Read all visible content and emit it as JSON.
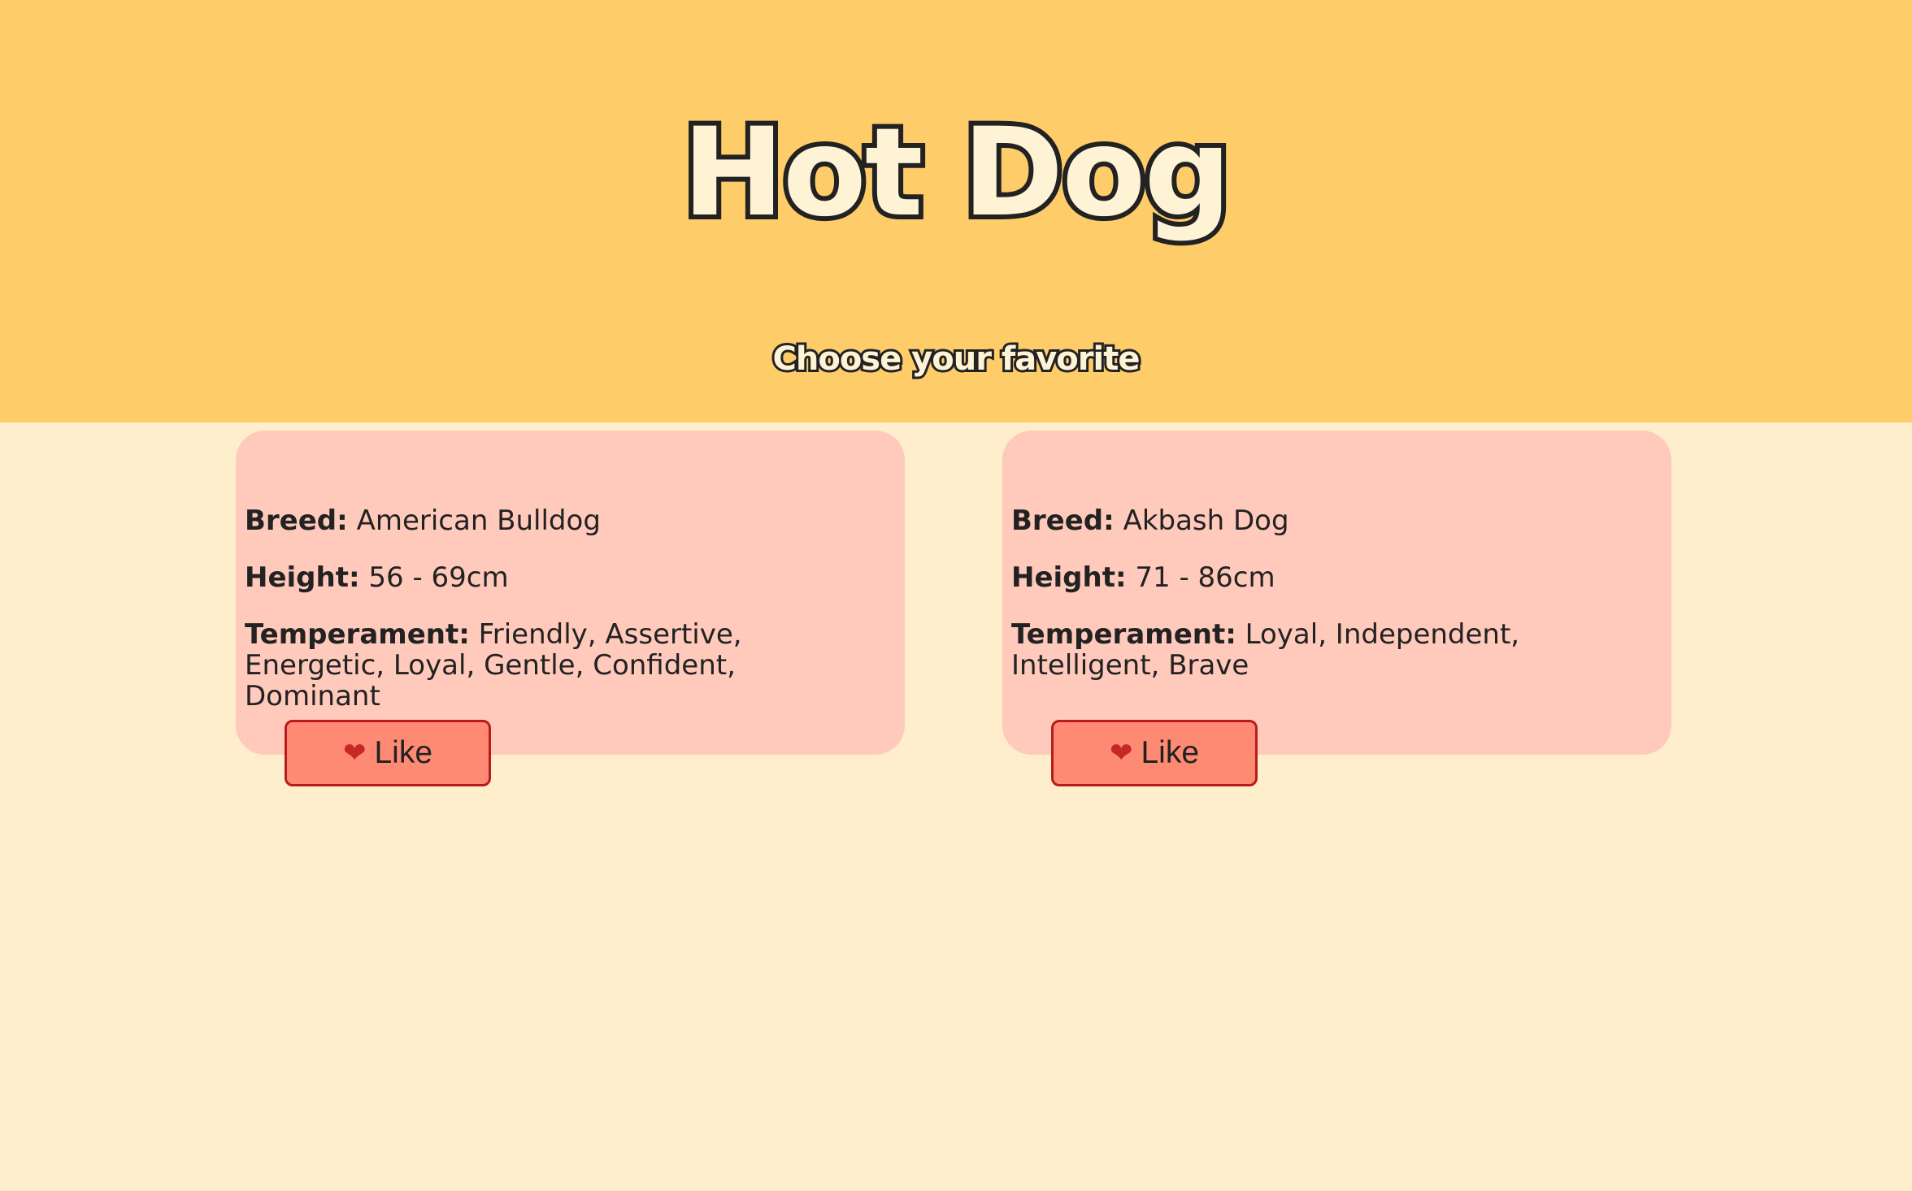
{
  "header": {
    "title": "Hot Dog",
    "subtitle": "Choose your favorite"
  },
  "cards": [
    {
      "breed_label": "Breed:",
      "breed": "American Bulldog",
      "height_label": "Height:",
      "height": "56 - 69cm",
      "temperament_label": "Temperament:",
      "temperament": "Friendly, Assertive, Energetic, Loyal, Gentle, Confident, Dominant",
      "like_icon": "❤",
      "like_label": "Like"
    },
    {
      "breed_label": "Breed:",
      "breed": "Akbash Dog",
      "height_label": "Height:",
      "height": "71 - 86cm",
      "temperament_label": "Temperament:",
      "temperament": "Loyal, Independent, Intelligent, Brave",
      "like_icon": "❤",
      "like_label": "Like"
    }
  ],
  "colors": {
    "header_bg": "#ffcc6a",
    "page_bg": "#ffeecc",
    "card_bg": "#ffcabb",
    "button_bg": "#ff8a73",
    "button_border": "#b71c1c",
    "heart": "#c62828"
  }
}
